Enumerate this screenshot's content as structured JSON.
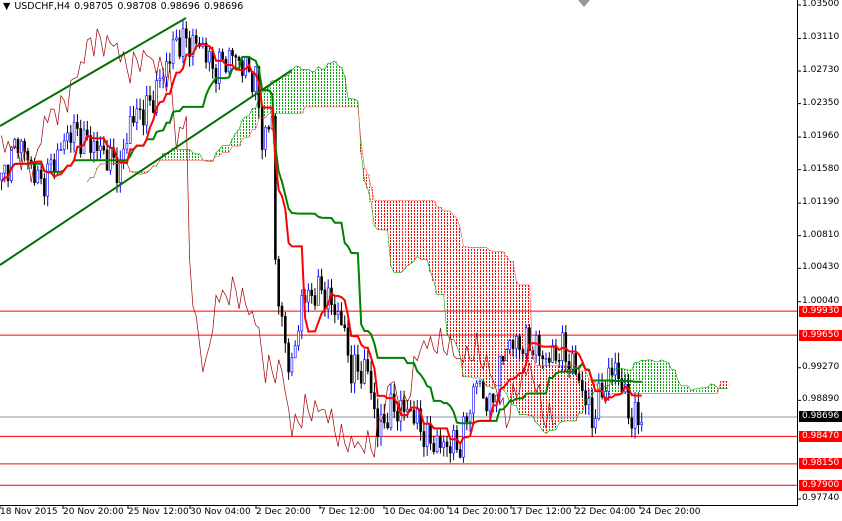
{
  "header": {
    "arrow": "▼",
    "symbol": "USDCHF,H4",
    "open": "0.98705",
    "high": "0.98708",
    "low": "0.98696",
    "close": "0.98696"
  },
  "price_axis": [
    "1.03500",
    "1.03110",
    "1.02730",
    "1.02350",
    "1.01960",
    "1.01580",
    "1.01190",
    "1.00810",
    "1.00430",
    "1.00040",
    "0.99270",
    "0.98890",
    "0.97740"
  ],
  "levels": [
    {
      "label": "0.99930",
      "price": 0.9993,
      "color": "#ff0000"
    },
    {
      "label": "0.99650",
      "price": 0.9965,
      "color": "#ff0000"
    },
    {
      "label": "0.98470",
      "price": 0.9847,
      "color": "#ff0000"
    },
    {
      "label": "0.98150",
      "price": 0.9815,
      "color": "#ff0000"
    },
    {
      "label": "0.97900",
      "price": 0.979,
      "color": "#ff0000"
    }
  ],
  "current": {
    "label": "0.98696",
    "price": 0.98696
  },
  "time_axis": [
    "18 Nov 2015",
    "20 Nov 20:00",
    "25 Nov 12:00",
    "30 Nov 04:00",
    "2 Dec 20:00",
    "7 Dec 12:00",
    "10 Dec 04:00",
    "14 Dec 20:00",
    "17 Dec 12:00",
    "22 Dec 04:00",
    "24 Dec 20:00"
  ],
  "colors": {
    "tenkan": "#ff0000",
    "kijun": "#008000",
    "chikou": "#a00000",
    "cloud_up": "#00a000",
    "cloud_down": "#ff0000",
    "trendline": "#007000"
  },
  "chart_data": {
    "type": "candlestick",
    "title": "USDCHF,H4",
    "ylim": [
      0.9774,
      1.035
    ],
    "keypoints": [
      [
        0,
        1.0146
      ],
      [
        5,
        1.0193
      ],
      [
        12,
        1.014
      ],
      [
        21,
        1.0204
      ],
      [
        30,
        1.0181
      ],
      [
        36,
        1.0158
      ],
      [
        39,
        1.0216
      ],
      [
        45,
        1.0233
      ],
      [
        53,
        1.0309
      ],
      [
        61,
        1.0303
      ],
      [
        64,
        1.0274
      ],
      [
        70,
        1.0292
      ],
      [
        77,
        1.0263
      ],
      [
        79,
        1.0193
      ],
      [
        82,
        1.0216
      ],
      [
        83,
        1.0053
      ],
      [
        85,
        0.9971
      ],
      [
        88,
        0.9924
      ],
      [
        91,
        1.0006
      ],
      [
        97,
        1.0018
      ],
      [
        103,
        0.9983
      ],
      [
        106,
        0.9924
      ],
      [
        111,
        0.9924
      ],
      [
        114,
        0.9854
      ],
      [
        118,
        0.9878
      ],
      [
        124,
        0.9878
      ],
      [
        129,
        0.9843
      ],
      [
        133,
        0.9837
      ],
      [
        139,
        0.9837
      ],
      [
        144,
        0.9913
      ],
      [
        148,
        0.9878
      ],
      [
        153,
        0.9954
      ],
      [
        161,
        0.9954
      ],
      [
        165,
        0.9936
      ],
      [
        170,
        0.9948
      ],
      [
        174,
        0.9924
      ],
      [
        179,
        0.9866
      ],
      [
        182,
        0.9901
      ],
      [
        186,
        0.993
      ],
      [
        191,
        0.9866
      ],
      [
        194,
        0.987
      ]
    ]
  }
}
